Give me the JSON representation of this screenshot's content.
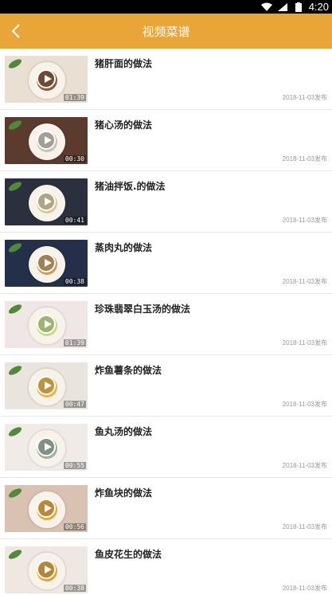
{
  "status_bar": {
    "time": "4:20"
  },
  "app_bar": {
    "title": "视频菜谱",
    "back_icon": "chevron-left-icon"
  },
  "colors": {
    "accent": "#e9a537"
  },
  "recipes": [
    {
      "title": "猪肝面的做法",
      "duration": "01:39",
      "date": "2018-11-03发布",
      "bg": "#e9dfd3",
      "food": "#8a5a3a"
    },
    {
      "title": "猪心汤的做法",
      "duration": "00:30",
      "date": "2018-11-03发布",
      "bg": "#5a3b2e",
      "food": "#c9c2b4"
    },
    {
      "title": "猪油拌饭.的做法",
      "duration": "00:41",
      "date": "2018-11-03发布",
      "bg": "#2c2f3d",
      "food": "#d9c89c"
    },
    {
      "title": "蒸肉丸的做法",
      "duration": "00:38",
      "date": "2018-11-03发布",
      "bg": "#243049",
      "food": "#c99b64"
    },
    {
      "title": "珍珠翡翠白玉汤的做法",
      "duration": "01:39",
      "date": "2018-11-03发布",
      "bg": "#f1e6e6",
      "food": "#c8d98a"
    },
    {
      "title": "炸鱼薯条的做法",
      "duration": "00:47",
      "date": "2018-11-03发布",
      "bg": "#eae4de",
      "food": "#e8b44a"
    },
    {
      "title": "鱼丸汤的做法",
      "duration": "00:55",
      "date": "2018-11-03发布",
      "bg": "#f0ebe6",
      "food": "#9bb1a0"
    },
    {
      "title": "炸鱼块的做法",
      "duration": "00:56",
      "date": "2018-11-03发布",
      "bg": "#d9c2b2",
      "food": "#e6a83e"
    },
    {
      "title": "鱼皮花生的做法",
      "duration": "00:38",
      "date": "2018-11-03发布",
      "bg": "#efe8e2",
      "food": "#e0a340"
    }
  ]
}
